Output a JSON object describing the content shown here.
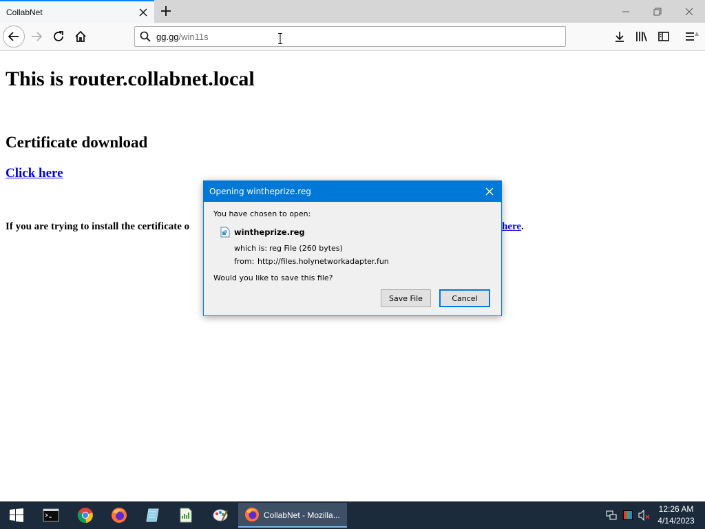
{
  "browser": {
    "tab_title": "CollabNet",
    "url_host": "gg.gg",
    "url_path": "/win11s"
  },
  "page": {
    "heading": "This is router.collabnet.local",
    "subheading": "Certificate download",
    "click_link": "Click here",
    "info_text_start": "If you are trying to install the certificate o",
    "info_link": "here",
    "info_text_end": "."
  },
  "dialog": {
    "title": "Opening wintheprize.reg",
    "chosen_label": "You have chosen to open:",
    "file_name": "wintheprize.reg",
    "which_is_label": "which is:",
    "which_is_value": "reg File (260 bytes)",
    "from_label": "from:",
    "from_value": "http://files.holynetworkadapter.fun",
    "question": "Would you like to save this file?",
    "save_label": "Save File",
    "cancel_label": "Cancel"
  },
  "taskbar": {
    "active_window_label": "CollabNet - Mozilla...",
    "time": "12:26 AM",
    "date": "4/14/2023"
  },
  "colors": {
    "accent": "#0078d7",
    "taskbar": "#1b2b3c",
    "link": "#0000ee"
  }
}
